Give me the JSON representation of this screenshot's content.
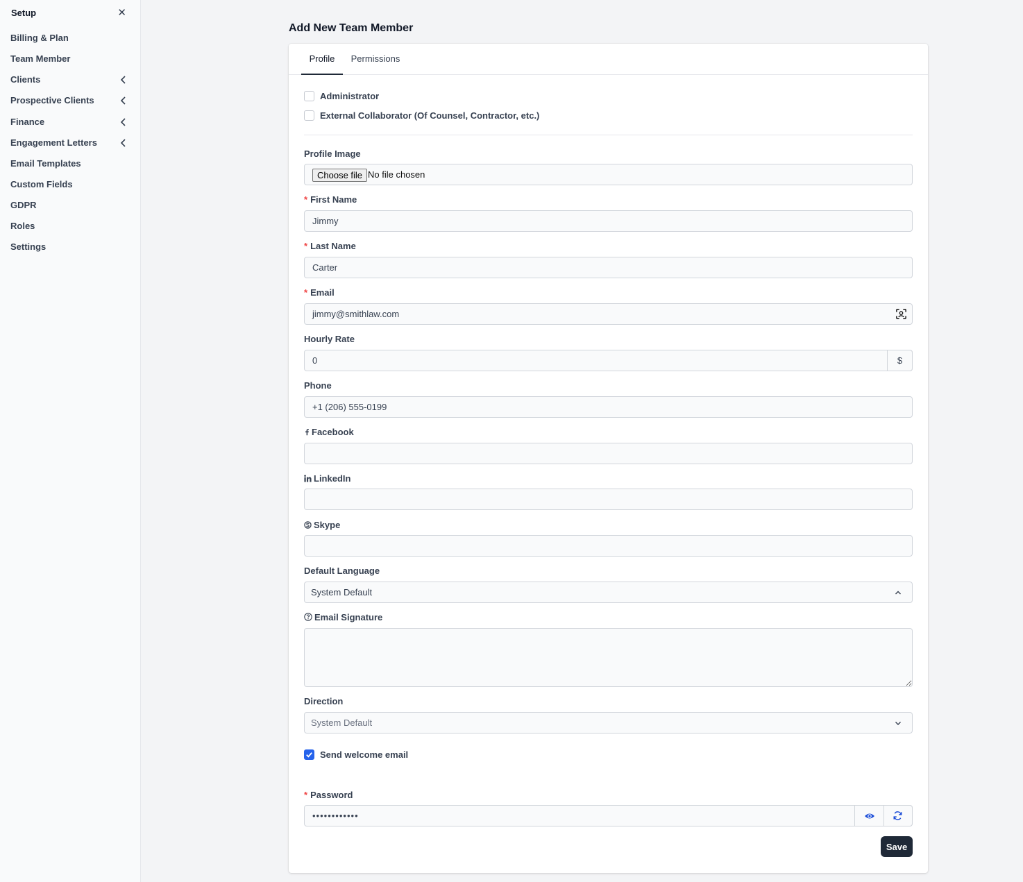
{
  "sidebar": {
    "title": "Setup",
    "close_icon": "close-icon",
    "items": [
      {
        "label": "Billing & Plan",
        "has_submenu": false
      },
      {
        "label": "Team Member",
        "has_submenu": false
      },
      {
        "label": "Clients",
        "has_submenu": true
      },
      {
        "label": "Prospective Clients",
        "has_submenu": true
      },
      {
        "label": "Finance",
        "has_submenu": true
      },
      {
        "label": "Engagement Letters",
        "has_submenu": true
      },
      {
        "label": "Email Templates",
        "has_submenu": false
      },
      {
        "label": "Custom Fields",
        "has_submenu": false
      },
      {
        "label": "GDPR",
        "has_submenu": false
      },
      {
        "label": "Roles",
        "has_submenu": false
      },
      {
        "label": "Settings",
        "has_submenu": false
      }
    ]
  },
  "page": {
    "title": "Add New Team Member"
  },
  "tabs": [
    {
      "label": "Profile",
      "active": true
    },
    {
      "label": "Permissions",
      "active": false
    }
  ],
  "form": {
    "administrator": {
      "label": "Administrator",
      "checked": false
    },
    "external_collaborator": {
      "label": "External Collaborator (Of Counsel, Contractor, etc.)",
      "checked": false
    },
    "profile_image": {
      "label": "Profile Image",
      "button": "Choose file",
      "status": "No file chosen"
    },
    "first_name": {
      "label": "First Name",
      "required": "*",
      "value": "Jimmy"
    },
    "last_name": {
      "label": "Last Name",
      "required": "*",
      "value": "Carter"
    },
    "email": {
      "label": "Email",
      "required": "*",
      "value": "jimmy@smithlaw.com",
      "icon": "contact-card-icon"
    },
    "hourly_rate": {
      "label": "Hourly Rate",
      "value": "0",
      "addon": "$"
    },
    "phone": {
      "label": "Phone",
      "value": "+1 (206) 555-0199"
    },
    "facebook": {
      "label": "Facebook",
      "value": "",
      "icon": "facebook-icon"
    },
    "linkedin": {
      "label": "LinkedIn",
      "value": "",
      "icon": "linkedin-icon"
    },
    "skype": {
      "label": "Skype",
      "value": "",
      "icon": "skype-icon"
    },
    "default_language": {
      "label": "Default Language",
      "value": "System Default",
      "chevron": "chevron-up-icon"
    },
    "email_signature": {
      "label": "Email Signature",
      "value": "",
      "icon": "help-circle-icon"
    },
    "direction": {
      "label": "Direction",
      "value": "System Default",
      "chevron": "chevron-down-icon"
    },
    "send_welcome_email": {
      "label": "Send welcome email",
      "checked": true
    },
    "password": {
      "label": "Password",
      "required": "*",
      "value": "••••••••••••",
      "show_icon": "eye-icon",
      "generate_icon": "refresh-icon"
    },
    "save_label": "Save"
  },
  "colors": {
    "accent": "#2563eb",
    "required": "#ef4444",
    "primary_button": "#1f2937"
  }
}
